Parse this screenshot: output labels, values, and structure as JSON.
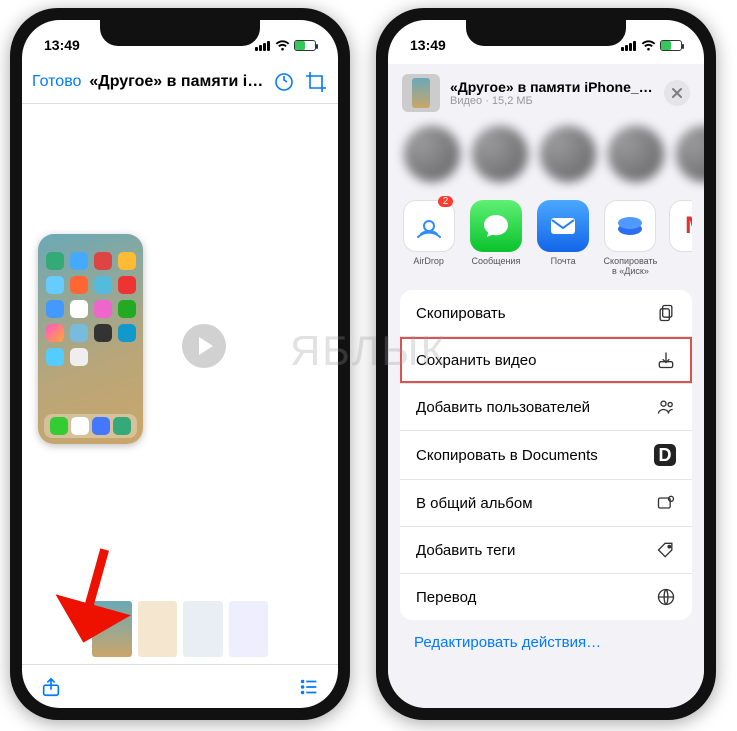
{
  "status": {
    "time": "13:49"
  },
  "left": {
    "done": "Готово",
    "title": "«Другое» в памяти iPh...",
    "thumbs": [
      "t1",
      "t2",
      "t3",
      "t4"
    ]
  },
  "right": {
    "header": {
      "title": "«Другое» в памяти iPhone_ откуда б...",
      "subtitle": "Видео · 15,2 МБ"
    },
    "apps": [
      {
        "name": "AirDrop",
        "label": "AirDrop",
        "bg": "#ffffff",
        "border": "#4aa0ff",
        "badge": "2"
      },
      {
        "name": "Messages",
        "label": "Сообщения",
        "bg": "#34c759"
      },
      {
        "name": "Mail",
        "label": "Почта",
        "bg": "#1e7dff"
      },
      {
        "name": "YaDisk",
        "label": "Скопировать в «Диск»",
        "bg": "#ffffff"
      },
      {
        "name": "Gmail",
        "label": "",
        "bg": "#ffffff"
      }
    ],
    "actions": [
      {
        "key": "copy",
        "label": "Скопировать"
      },
      {
        "key": "save-video",
        "label": "Сохранить видео",
        "highlight": true
      },
      {
        "key": "add-people",
        "label": "Добавить пользователей"
      },
      {
        "key": "copy-docs",
        "label": "Скопировать в Documents"
      },
      {
        "key": "shared-album",
        "label": "В общий альбом"
      },
      {
        "key": "add-tags",
        "label": "Добавить теги"
      },
      {
        "key": "translate",
        "label": "Перевод"
      }
    ],
    "edit": "Редактировать действия…"
  },
  "watermark": "ЯБЛЫК"
}
